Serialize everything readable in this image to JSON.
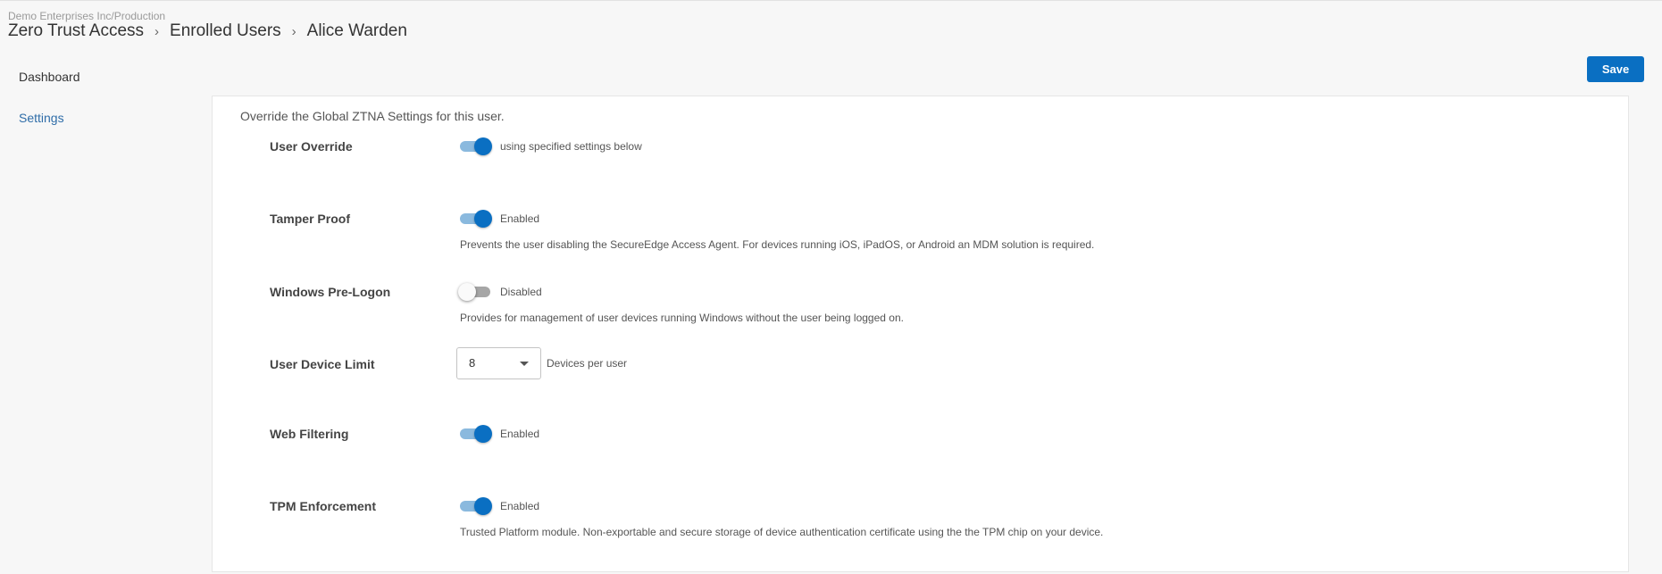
{
  "header": {
    "org_path": "Demo Enterprises Inc/Production",
    "breadcrumb": [
      "Zero Trust Access",
      "Enrolled Users",
      "Alice Warden"
    ],
    "separator": "›"
  },
  "nav": {
    "items": [
      {
        "label": "Dashboard",
        "active": false
      },
      {
        "label": "Settings",
        "active": true
      }
    ]
  },
  "toolbar": {
    "save_label": "Save",
    "accent_color": "#0a6fc2"
  },
  "panel": {
    "intro": "Override the Global ZTNA Settings for this user.",
    "settings": {
      "user_override": {
        "label": "User Override",
        "enabled": true,
        "state_text": "using specified settings below"
      },
      "tamper_proof": {
        "label": "Tamper Proof",
        "enabled": true,
        "state_text": "Enabled",
        "description": "Prevents the user disabling the SecureEdge Access Agent. For devices running iOS, iPadOS, or Android an MDM solution is required."
      },
      "windows_prelogon": {
        "label": "Windows Pre-Logon",
        "enabled": false,
        "state_text": "Disabled",
        "description": "Provides for management of user devices running Windows without the user being logged on."
      },
      "device_limit": {
        "label": "User Device Limit",
        "value": "8",
        "unit": "Devices per user"
      },
      "web_filtering": {
        "label": "Web Filtering",
        "enabled": true,
        "state_text": "Enabled"
      },
      "tpm_enforcement": {
        "label": "TPM Enforcement",
        "enabled": true,
        "state_text": "Enabled",
        "description": "Trusted Platform module. Non-exportable and secure storage of device authentication certificate using the the TPM chip on your device."
      }
    }
  }
}
